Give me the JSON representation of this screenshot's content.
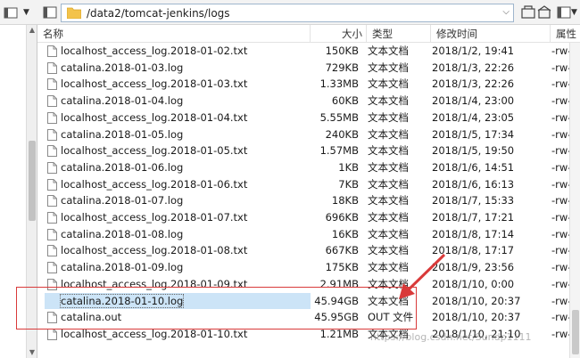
{
  "address": {
    "path": "/data2/tomcat-jenkins/logs"
  },
  "columns": {
    "name": "名称",
    "size": "大小",
    "type": "类型",
    "date": "修改时间",
    "attr": "属性"
  },
  "files": [
    {
      "name": "localhost_access_log.2018-01-02.txt",
      "size": "150KB",
      "type": "文本文档",
      "date": "2018/1/2, 19:41",
      "attr": "-rw-r"
    },
    {
      "name": "catalina.2018-01-03.log",
      "size": "729KB",
      "type": "文本文档",
      "date": "2018/1/3, 22:26",
      "attr": "-rw-r"
    },
    {
      "name": "localhost_access_log.2018-01-03.txt",
      "size": "1.33MB",
      "type": "文本文档",
      "date": "2018/1/3, 22:26",
      "attr": "-rw-r"
    },
    {
      "name": "catalina.2018-01-04.log",
      "size": "60KB",
      "type": "文本文档",
      "date": "2018/1/4, 23:00",
      "attr": "-rw-r"
    },
    {
      "name": "localhost_access_log.2018-01-04.txt",
      "size": "5.55MB",
      "type": "文本文档",
      "date": "2018/1/4, 23:05",
      "attr": "-rw-r"
    },
    {
      "name": "catalina.2018-01-05.log",
      "size": "240KB",
      "type": "文本文档",
      "date": "2018/1/5, 17:34",
      "attr": "-rw-r"
    },
    {
      "name": "localhost_access_log.2018-01-05.txt",
      "size": "1.57MB",
      "type": "文本文档",
      "date": "2018/1/5, 19:50",
      "attr": "-rw-r"
    },
    {
      "name": "catalina.2018-01-06.log",
      "size": "1KB",
      "type": "文本文档",
      "date": "2018/1/6, 14:51",
      "attr": "-rw-r"
    },
    {
      "name": "localhost_access_log.2018-01-06.txt",
      "size": "7KB",
      "type": "文本文档",
      "date": "2018/1/6, 16:13",
      "attr": "-rw-r"
    },
    {
      "name": "catalina.2018-01-07.log",
      "size": "18KB",
      "type": "文本文档",
      "date": "2018/1/7, 15:33",
      "attr": "-rw-r"
    },
    {
      "name": "localhost_access_log.2018-01-07.txt",
      "size": "696KB",
      "type": "文本文档",
      "date": "2018/1/7, 17:21",
      "attr": "-rw-r"
    },
    {
      "name": "catalina.2018-01-08.log",
      "size": "16KB",
      "type": "文本文档",
      "date": "2018/1/8, 17:14",
      "attr": "-rw-r"
    },
    {
      "name": "localhost_access_log.2018-01-08.txt",
      "size": "667KB",
      "type": "文本文档",
      "date": "2018/1/8, 17:17",
      "attr": "-rw-r"
    },
    {
      "name": "catalina.2018-01-09.log",
      "size": "175KB",
      "type": "文本文档",
      "date": "2018/1/9, 23:56",
      "attr": "-rw-r"
    },
    {
      "name": "localhost_access_log.2018-01-09.txt",
      "size": "2.91MB",
      "type": "文本文档",
      "date": "2018/1/10, 0:00",
      "attr": "-rw-r"
    },
    {
      "name": "catalina.2018-01-10.log",
      "size": "45.94GB",
      "type": "文本文档",
      "date": "2018/1/10, 20:37",
      "attr": "-rw-r",
      "selected": true
    },
    {
      "name": "catalina.out",
      "size": "45.95GB",
      "type": "OUT 文件",
      "date": "2018/1/10, 20:37",
      "attr": "-rw-r"
    },
    {
      "name": "localhost_access_log.2018-01-10.txt",
      "size": "1.21MB",
      "type": "文本文档",
      "date": "2018/1/10, 21:10",
      "attr": "-rw-r"
    }
  ],
  "watermark": "https://blog.csdn.net/Sundp1111",
  "colors": {
    "selection": "#cce4f7",
    "annotation": "#d93a3a",
    "folder": "#f3c34b"
  },
  "icons": {
    "left_toolbar": [
      "folder-icon",
      "dropdown-icon"
    ],
    "right_toolbar": [
      "refresh-icon",
      "home-icon",
      "panel-icon",
      "dropdown-icon"
    ]
  }
}
